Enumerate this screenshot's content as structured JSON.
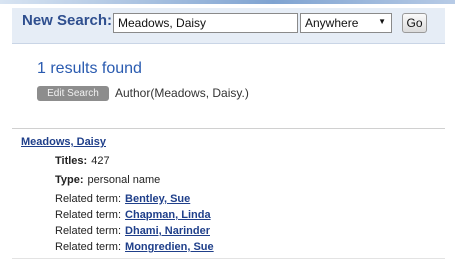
{
  "search": {
    "label": "New Search:",
    "query": "Meadows, Daisy",
    "scope": "Anywhere",
    "go_label": "Go"
  },
  "results": {
    "count_text": "1 results found",
    "edit_label": "Edit Search",
    "query_summary": "Author(Meadows, Daisy.)"
  },
  "record": {
    "author": "Meadows, Daisy",
    "titles_label": "Titles:",
    "titles_count": "427",
    "type_label": "Type:",
    "type_value": "personal name",
    "related_label": "Related term:",
    "related_terms": [
      "Bentley, Sue",
      "Chapman, Linda",
      "Dhami, Narinder",
      "Mongredien, Sue"
    ]
  }
}
